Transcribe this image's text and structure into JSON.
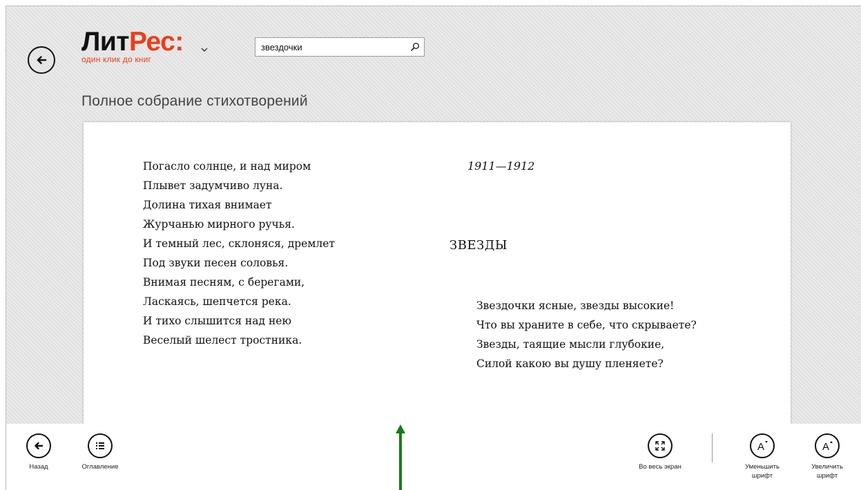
{
  "header": {
    "logo_part1": "Лит",
    "logo_part2": "Рес:",
    "logo_tagline": "один клик до книг",
    "search_value": "звездочки"
  },
  "book": {
    "title": "Полное собрание стихотворений"
  },
  "page": {
    "left_column_lines": [
      "Погасло солнце, и над миром",
      "Плывет задумчиво луна.",
      "Долина тихая внимает",
      "Журчанью мирного ручья.",
      "И темный лес, склоняся, дремлет",
      "Под звуки песен соловья.",
      "Внимая песням, с берегами,",
      "Ласкаясь, шепчется река.",
      "И тихо слышится над нею",
      "Веселый шелест тростника."
    ],
    "date": "1911—1912",
    "poem_heading": "ЗВЕЗДЫ",
    "right_column_lines": [
      "Звездочки ясные, звезды высокие!",
      "Что вы храните в себе, что скрываете?",
      "Звезды, таящие мысли глубокие,",
      "Силой какою вы душу пленяете?"
    ]
  },
  "appbar": {
    "back_label": "Назад",
    "toc_label": "Оглавление",
    "fullscreen_label": "Во весь экран",
    "decrease_font_line1": "Уменьшить",
    "decrease_font_line2": "шрифт",
    "increase_font_line1": "Увеличить",
    "increase_font_line2": "шрифт"
  },
  "colors": {
    "brand_orange": "#e8401c",
    "annotation_arrow": "#1a7a1a"
  },
  "icons": [
    "back-arrow-icon",
    "chevron-down-icon",
    "search-icon",
    "table-of-contents-icon",
    "fullscreen-icon",
    "decrease-font-icon",
    "increase-font-icon"
  ]
}
